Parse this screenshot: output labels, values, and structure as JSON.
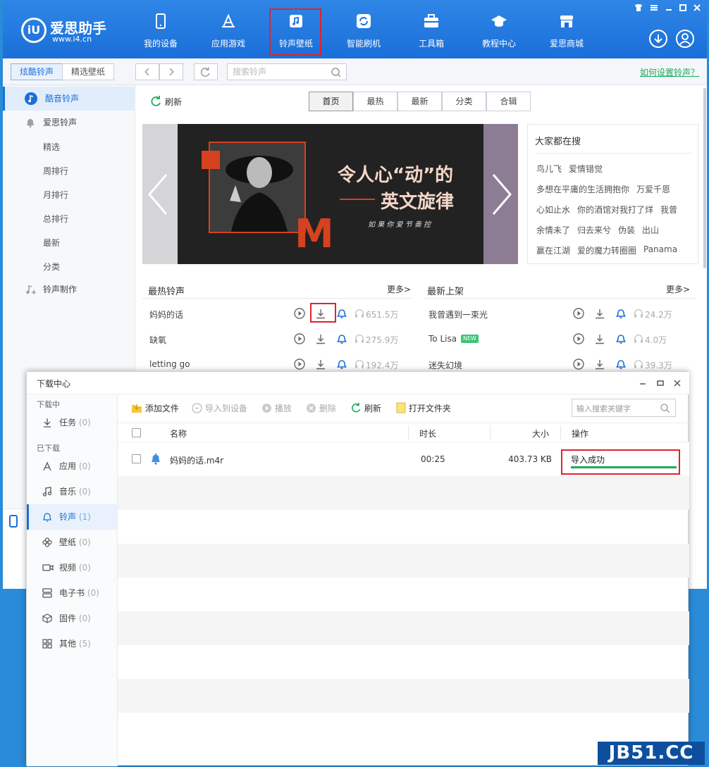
{
  "app": {
    "logo_text": "爱思助手",
    "logo_url": "www.i4.cn"
  },
  "nav": [
    {
      "label": "我的设备"
    },
    {
      "label": "应用游戏"
    },
    {
      "label": "铃声壁纸"
    },
    {
      "label": "智能刷机"
    },
    {
      "label": "工具箱"
    },
    {
      "label": "教程中心"
    },
    {
      "label": "爱思商城"
    }
  ],
  "toolbar": {
    "tab1": "炫酷铃声",
    "tab2": "精选壁纸",
    "search_placeholder": "搜索铃声",
    "help_link": "如何设置铃声？"
  },
  "sidebar": {
    "items": [
      "酷音铃声",
      "爱思铃声",
      "铃声制作"
    ],
    "sub": [
      "精选",
      "周排行",
      "月排行",
      "总排行",
      "最新",
      "分类"
    ]
  },
  "content": {
    "refresh": "刷新",
    "segments": [
      "首页",
      "最热",
      "最新",
      "分类",
      "合辑"
    ],
    "banner": {
      "line1": "令人心“动”的",
      "line2": "英文旋律",
      "line3": "如 果 你 爱 节 奏 控",
      "big_letter": "M"
    },
    "hot_search": {
      "title": "大家都在搜",
      "items": [
        [
          "鸟儿飞",
          "爱情错觉"
        ],
        [
          "多想在平庸的生活拥抱你",
          "万爱千恩"
        ],
        [
          "心如止水",
          "你的酒馆对我打了烊",
          "我曾"
        ],
        [
          "余情未了",
          "归去来兮",
          "伪装",
          "出山"
        ],
        [
          "赢在江湖",
          "爱的魔力转圈圈",
          "Panama"
        ]
      ]
    },
    "hot_list": {
      "title": "最热铃声",
      "more": "更多>",
      "rows": [
        {
          "name": "妈妈的话",
          "count": "651.5万"
        },
        {
          "name": "缺氧",
          "count": "275.9万"
        },
        {
          "name": "letting go",
          "count": "192.4万"
        }
      ]
    },
    "new_list": {
      "title": "最新上架",
      "more": "更多>",
      "new_badge": "NEW",
      "rows": [
        {
          "name": "我曾遇到一束光",
          "count": "24.2万"
        },
        {
          "name": "To Lisa",
          "count": "4.0万"
        },
        {
          "name": "迷失幻境",
          "count": "39.3万"
        }
      ]
    }
  },
  "download": {
    "title": "下载中心",
    "groups": {
      "downloading": "下载中",
      "downloaded": "已下载"
    },
    "side": [
      {
        "label": "任务",
        "count": "(0)"
      },
      {
        "label": "应用",
        "count": "(0)"
      },
      {
        "label": "音乐",
        "count": "(0)"
      },
      {
        "label": "铃声",
        "count": "(1)"
      },
      {
        "label": "壁纸",
        "count": "(0)"
      },
      {
        "label": "视频",
        "count": "(0)"
      },
      {
        "label": "电子书",
        "count": "(0)"
      },
      {
        "label": "固件",
        "count": "(0)"
      },
      {
        "label": "其他",
        "count": "(5)"
      }
    ],
    "toolbar": {
      "add": "添加文件",
      "import": "导入到设备",
      "play": "播放",
      "delete": "删除",
      "refresh": "刷新",
      "open": "打开文件夹",
      "search_placeholder": "输入搜索关键字"
    },
    "columns": {
      "name": "名称",
      "duration": "时长",
      "size": "大小",
      "action": "操作"
    },
    "rows": [
      {
        "name": "妈妈的话.m4r",
        "duration": "00:25",
        "size": "403.73 KB",
        "status": "导入成功",
        "progress": 1.0
      }
    ]
  },
  "watermark": "JB51.CC",
  "colors": {
    "accent": "#1a6fd8",
    "highlight": "#e0232d",
    "success": "#1aab5c",
    "banner_red": "#d6411f"
  }
}
